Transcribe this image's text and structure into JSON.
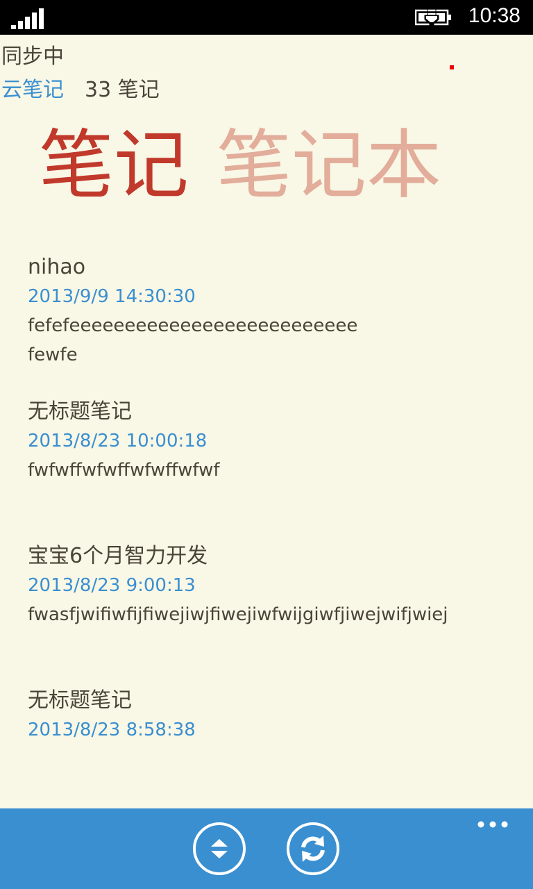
{
  "status_bar": {
    "time": "10:38",
    "icons": [
      "signal-icon",
      "battery-charging-icon"
    ]
  },
  "header": {
    "sync_status": "同步中",
    "app_name": "云笔记",
    "note_count": "33 笔记"
  },
  "pivot": {
    "tabs": [
      {
        "label": "笔记",
        "active": true
      },
      {
        "label": "笔记本",
        "active": false
      }
    ]
  },
  "notes": [
    {
      "title": "nihao",
      "date": "2013/9/9 14:30:30",
      "preview": "fefefeeeeeeeeeeeeeeeeeeeeeeeeee\nfewfe"
    },
    {
      "title": "无标题笔记",
      "date": "2013/8/23 10:00:18",
      "preview": "fwfwffwfwffwfwffwfwf"
    },
    {
      "title": "宝宝6个月智力开发",
      "date": "2013/8/23 9:00:13",
      "preview": "fwasfjwifiwfijfiwejiwjfiwejiwfwijgiwfjiwejwifjwiej"
    },
    {
      "title": "无标题笔记",
      "date": "2013/8/23 8:58:38",
      "preview": ""
    }
  ],
  "app_bar": {
    "buttons": [
      {
        "icon": "sort-icon"
      },
      {
        "icon": "sync-icon"
      }
    ],
    "more_icon": "more-dots-icon"
  },
  "colors": {
    "accent": "#3a8fd0",
    "pivot_active": "#c0392b",
    "pivot_inactive": "#e2ad9a",
    "background": "#f9f7e6"
  }
}
